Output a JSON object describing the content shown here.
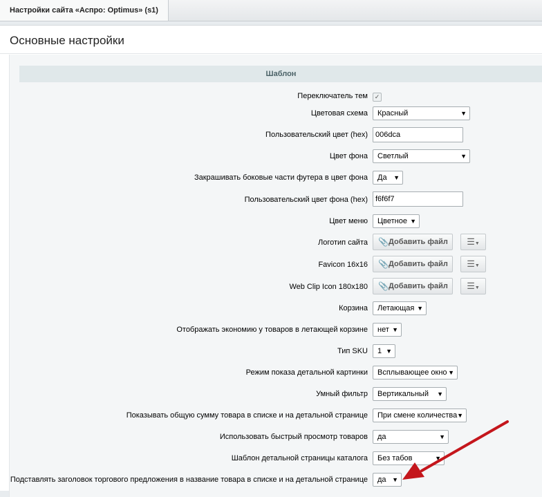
{
  "tab": {
    "title": "Настройки сайта «Аспро: Optimus» (s1)"
  },
  "page_title": "Основные настройки",
  "section_title": "Шаблон",
  "rows": [
    {
      "label": "Переключатель тем",
      "control": "checkbox",
      "checked": true
    },
    {
      "label": "Цветовая схема",
      "control": "select",
      "value": "Красный"
    },
    {
      "label": "Пользовательский цвет (hex)",
      "control": "input",
      "value": "006dca"
    },
    {
      "label": "Цвет фона",
      "control": "select",
      "value": "Светлый"
    },
    {
      "label": "Закрашивать боковые части футера в цвет фона",
      "control": "select",
      "value": "Да"
    },
    {
      "label": "Пользовательский цвет фона (hex)",
      "control": "input",
      "value": "f6f6f7"
    },
    {
      "label": "Цвет меню",
      "control": "select",
      "value": "Цветное"
    },
    {
      "label": "Логотип сайта",
      "control": "file",
      "button": "Добавить файл"
    },
    {
      "label": "Favicon 16x16",
      "control": "file",
      "button": "Добавить файл"
    },
    {
      "label": "Web Clip Icon 180x180",
      "control": "file",
      "button": "Добавить файл"
    },
    {
      "label": "Корзина",
      "control": "select",
      "value": "Летающая"
    },
    {
      "label": "Отображать экономию у товаров в летающей корзине",
      "control": "select",
      "value": "нет"
    },
    {
      "label": "Тип SKU",
      "control": "select",
      "value": "1"
    },
    {
      "label": "Режим показа детальной картинки",
      "control": "select",
      "value": "Всплывающее окно"
    },
    {
      "label": "Умный фильтр",
      "control": "select",
      "value": "Вертикальный"
    },
    {
      "label": "Показывать общую сумму товара в списке и на детальной странице",
      "control": "select",
      "value": "При смене количества"
    },
    {
      "label": "Использовать быстрый просмотр товаров",
      "control": "select",
      "value": "да"
    },
    {
      "label": "Шаблон детальной страницы каталога",
      "control": "select",
      "value": "Без табов"
    },
    {
      "label": "Подставлять заголовок торгового предложения в название товара в списке и на детальной странице",
      "control": "select",
      "value": "да"
    }
  ],
  "icons": {
    "paperclip": "paperclip-icon",
    "menu": "hamburger-menu-icon",
    "dropdown": "triangle-down-icon"
  },
  "colors": {
    "annotation_arrow": "#c4161c",
    "section_bg": "#e0e8ea"
  }
}
